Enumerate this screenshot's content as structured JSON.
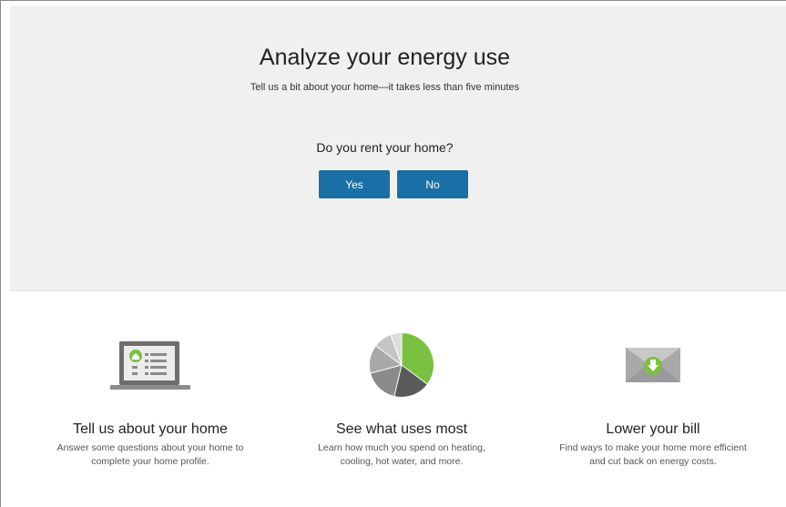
{
  "hero": {
    "title": "Analyze your energy use",
    "subtitle": "Tell us a bit about your home—it takes less than five minutes",
    "question": "Do you rent your home?",
    "yes_label": "Yes",
    "no_label": "No"
  },
  "features": [
    {
      "icon": "laptop-profile-icon",
      "title": "Tell us about your home",
      "description": "Answer some questions about your home to complete your home profile."
    },
    {
      "icon": "pie-chart-icon",
      "title": "See what uses most",
      "description": "Learn how much you spend on heating, cooling, hot water, and more."
    },
    {
      "icon": "envelope-download-icon",
      "title": "Lower your bill",
      "description": "Find ways to make your home more efficient and cut back on energy costs."
    }
  ],
  "colors": {
    "hero_bg": "#f0f0f0",
    "button_bg": "#1a6fa6",
    "accent_green": "#7ac142",
    "icon_gray": "#9b9b9b"
  }
}
